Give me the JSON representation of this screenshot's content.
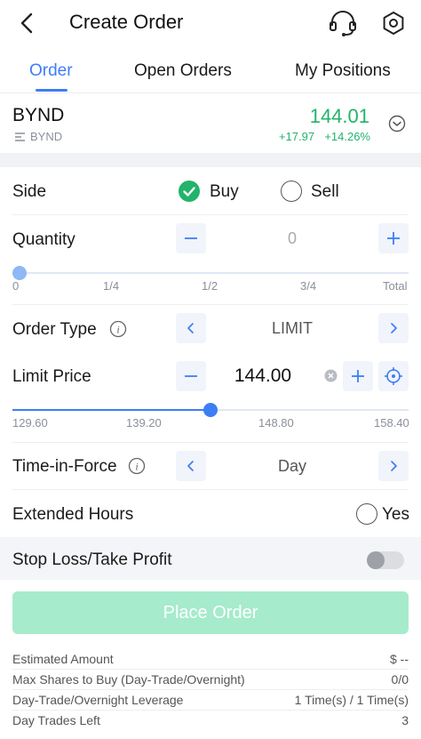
{
  "header": {
    "title": "Create Order"
  },
  "tabs": [
    {
      "label": "Order",
      "active": true
    },
    {
      "label": "Open Orders",
      "active": false
    },
    {
      "label": "My Positions",
      "active": false
    }
  ],
  "ticker": {
    "symbol": "BYND",
    "sub_symbol": "BYND",
    "price": "144.01",
    "change": "+17.97",
    "change_pct": "+14.26%"
  },
  "side": {
    "label": "Side",
    "buy_label": "Buy",
    "sell_label": "Sell",
    "selected": "Buy"
  },
  "quantity": {
    "label": "Quantity",
    "value": "0",
    "slider_fraction": 0,
    "ticks": [
      "0",
      "1/4",
      "1/2",
      "3/4",
      "Total"
    ]
  },
  "order_type": {
    "label": "Order Type",
    "value": "LIMIT"
  },
  "limit_price": {
    "label": "Limit Price",
    "value": "144.00",
    "slider_fraction": 0.5,
    "ticks": [
      "129.60",
      "139.20",
      "148.80",
      "158.40"
    ]
  },
  "time_in_force": {
    "label": "Time-in-Force",
    "value": "Day"
  },
  "extended_hours": {
    "label": "Extended Hours",
    "option_label": "Yes",
    "checked": false
  },
  "stop_loss": {
    "label": "Stop Loss/Take Profit",
    "enabled": false
  },
  "place_order": {
    "label": "Place Order",
    "enabled": false
  },
  "summary": [
    {
      "key": "Estimated Amount",
      "value": "$ --"
    },
    {
      "key": "Max Shares to Buy (Day-Trade/Overnight)",
      "value": "0/0"
    },
    {
      "key": "Day-Trade/Overnight Leverage",
      "value": "1 Time(s) / 1 Time(s)"
    },
    {
      "key": "Day Trades Left",
      "value": "3"
    }
  ],
  "colors": {
    "accent": "#3d7ef5",
    "positive": "#23b36b",
    "place_order_disabled": "#a6ebcb"
  }
}
